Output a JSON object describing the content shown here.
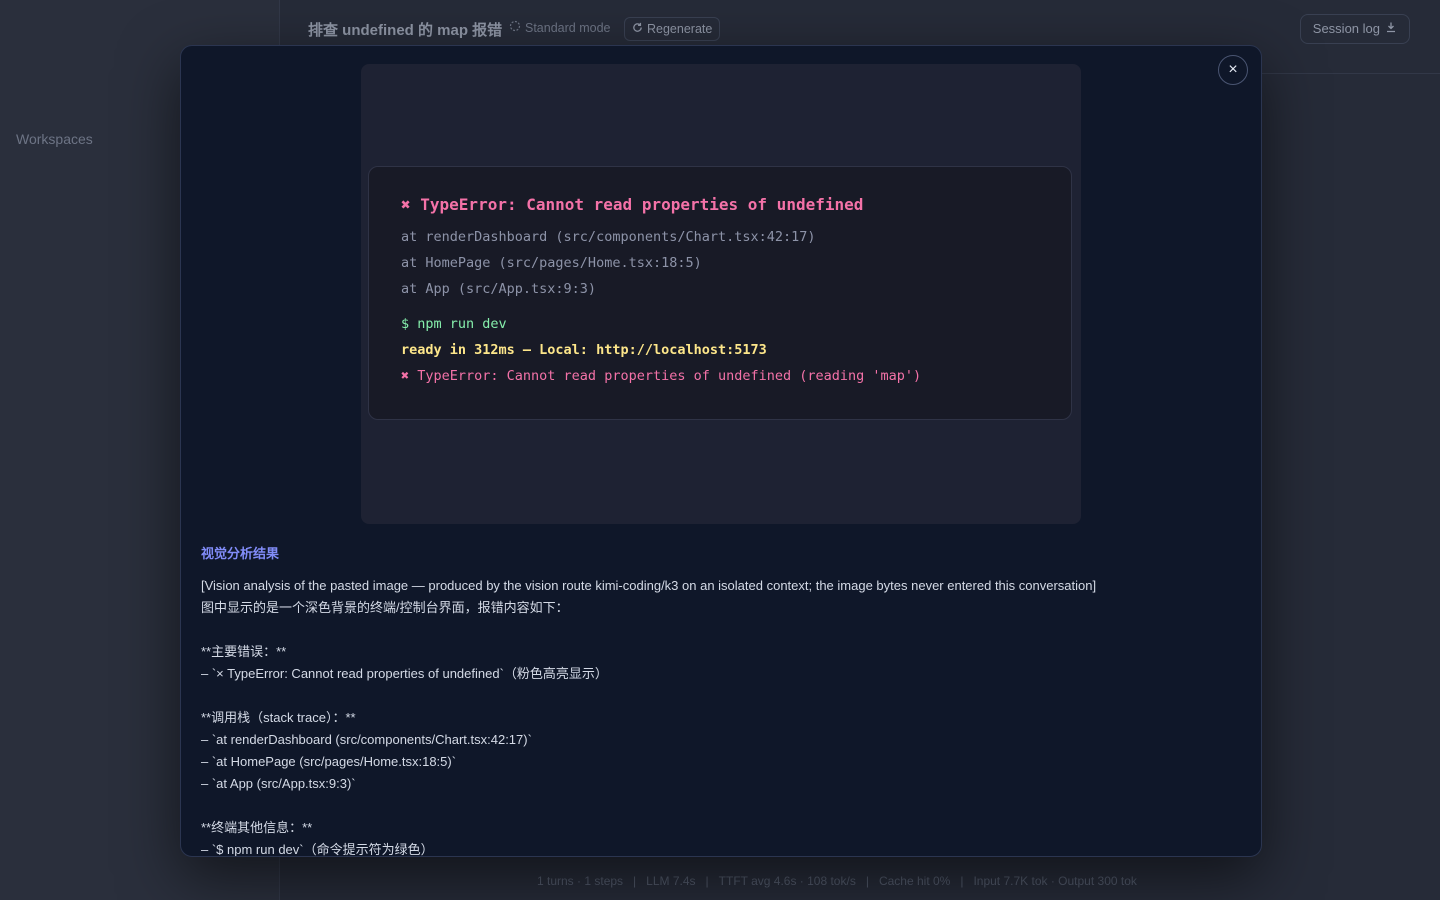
{
  "sidebar": {
    "workspaces_label": "Workspaces"
  },
  "header": {
    "title": "排查 undefined 的 map 报错",
    "mode_label": "Standard mode",
    "regenerate_label": "Regenerate",
    "session_log_label": "Session log"
  },
  "stats": {
    "turns": "1 turns · 1 steps",
    "llm": "LLM 7.4s",
    "ttft": "TTFT avg 4.6s · 108 tok/s",
    "cache": "Cache hit 0%",
    "tokens": "Input 7.7K tok · Output 300 tok"
  },
  "modal": {
    "close_label": "×",
    "terminal": {
      "error_title": "✖ TypeError: Cannot read properties of undefined",
      "stack": [
        "at renderDashboard (src/components/Chart.tsx:42:17)",
        "at HomePage (src/pages/Home.tsx:18:5)",
        "at App (src/App.tsx:9:3)"
      ],
      "command": "$ npm run dev",
      "ready": "ready in 312ms — Local: http://localhost:5173",
      "error_line": "✖ TypeError: Cannot read properties of undefined (reading 'map')"
    },
    "analysis": {
      "title": "视觉分析结果",
      "lines": [
        "[Vision analysis of the pasted image — produced by the vision route kimi-coding/k3 on an isolated context; the image bytes never entered this conversation]",
        "图中显示的是一个深色背景的终端/控制台界面，报错内容如下：",
        "",
        "**主要错误：**",
        "– `× TypeError: Cannot read properties of undefined`（粉色高亮显示）",
        "",
        "**调用栈（stack trace）：**",
        "– `at renderDashboard (src/components/Chart.tsx:42:17)`",
        "– `at HomePage (src/pages/Home.tsx:18:5)`",
        "– `at App (src/App.tsx:9:3)`",
        "",
        "**终端其他信息：**",
        "– `$ npm run dev`（命令提示符为绿色）"
      ]
    }
  },
  "colors": {
    "error_pink": "#f472a8",
    "prompt_green": "#86efac",
    "ready_yellow": "#fde68a",
    "accent_indigo": "#818cf8"
  }
}
